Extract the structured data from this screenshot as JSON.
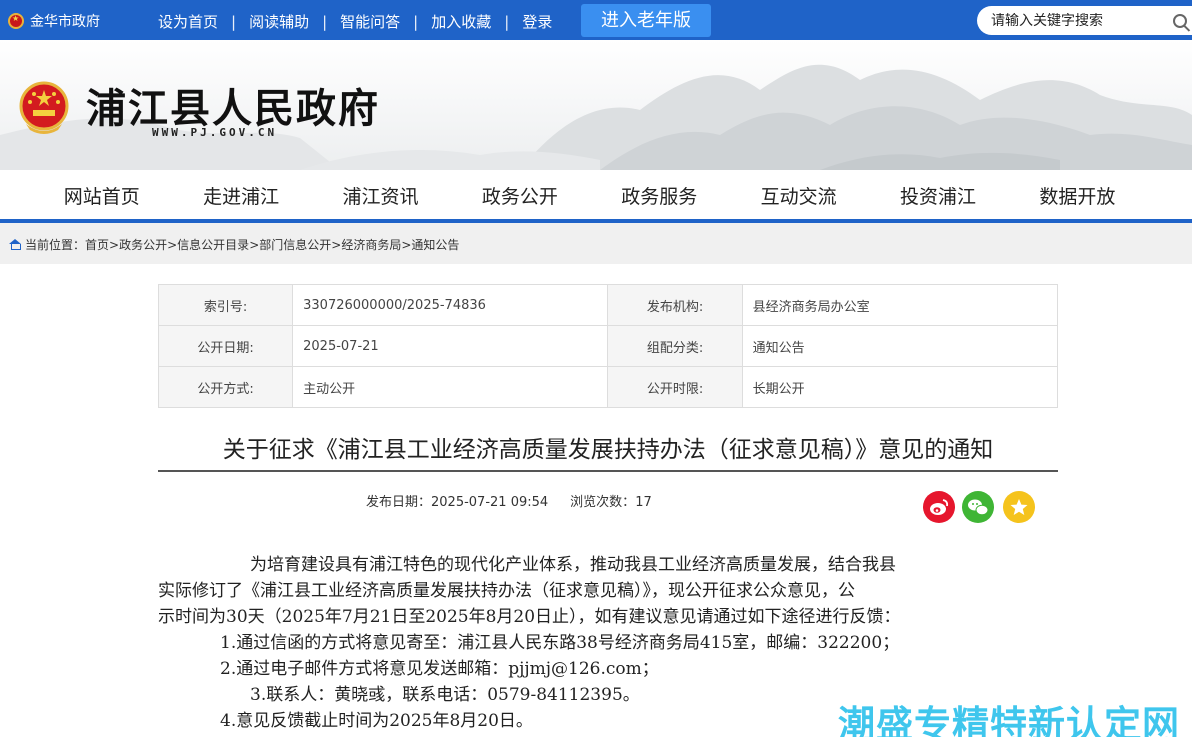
{
  "topbar": {
    "city": "金华市政府",
    "links": [
      "设为首页",
      "阅读辅助",
      "智能问答",
      "加入收藏",
      "登录"
    ],
    "elder_mode": "进入老年版",
    "search_placeholder": "请输入关键字搜索"
  },
  "header": {
    "title": "浦江县人民政府",
    "url": "WWW.PJ.GOV.CN"
  },
  "nav": [
    "网站首页",
    "走进浦江",
    "浦江资讯",
    "政务公开",
    "政务服务",
    "互动交流",
    "投资浦江",
    "数据开放"
  ],
  "breadcrumb": {
    "label": "当前位置：",
    "items": [
      "首页",
      "政务公开",
      "信息公开目录",
      "部门信息公开",
      "经济商务局",
      "通知公告"
    ],
    "sep": ">"
  },
  "meta": [
    {
      "k1": "索引号:",
      "v1": "330726000000/2025-74836",
      "k2": "发布机构:",
      "v2": "县经济商务局办公室"
    },
    {
      "k1": "公开日期:",
      "v1": "2025-07-21",
      "k2": "组配分类:",
      "v2": "通知公告"
    },
    {
      "k1": "公开方式:",
      "v1": "主动公开",
      "k2": "公开时限:",
      "v2": "长期公开"
    }
  ],
  "article": {
    "title": "关于征求《浦江县工业经济高质量发展扶持办法（征求意见稿）》意见的通知",
    "publish_label": "发布日期：",
    "publish_date": "2025-07-21 09:54",
    "views_label": "浏览次数：",
    "views": "17",
    "para1_a": "为培育建设具有浦江特色的现代化产业体系，推动我县工业经济高质量发展，结合我县",
    "para1_b": "实际修订了《浦江县工业经济高质量发展扶持办法（征求意见稿）》，现公开征求公众意见，公",
    "para1_c": "示时间为30天（2025年7月21日至2025年8月20日止），如有建议意见请通过如下途径进行反馈：",
    "item1": "1.通过信函的方式将意见寄至：浦江县人民东路38号经济商务局415室，邮编：322200；",
    "item2": "2.通过电子邮件方式将意见发送邮箱：pjjmj@126.com；",
    "item3": "3.联系人：黄晓彧，联系电话：0579-84112395。",
    "item4": "4.意见反馈截止时间为2025年8月20日。"
  },
  "watermark": "潮盛专精特新认定网",
  "colors": {
    "primary": "#1f63c8",
    "elder_button": "#3a8ff0",
    "watermark": "#2fc2ec"
  }
}
